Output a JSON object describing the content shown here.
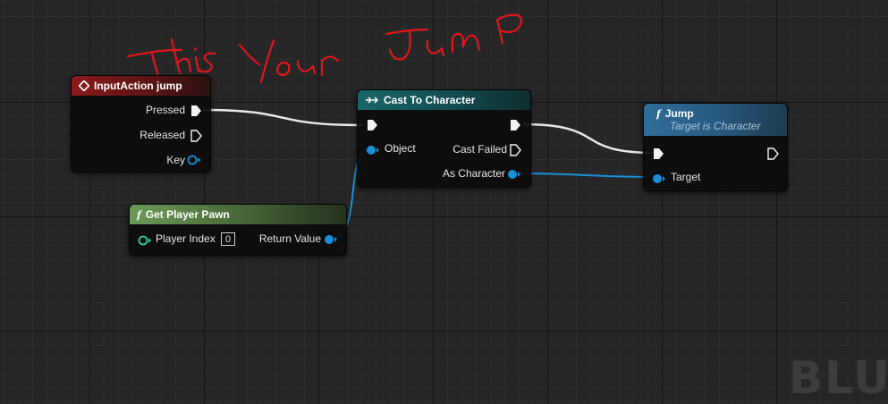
{
  "annotation": {
    "handwritten_text": "This Your Jump",
    "color": "#e0161c"
  },
  "watermark": {
    "text": "BLU"
  },
  "nodes": {
    "input_action": {
      "title": "InputAction jump",
      "icon": "diamond-event-icon",
      "pins": {
        "pressed": "Pressed",
        "released": "Released",
        "key": "Key"
      }
    },
    "cast": {
      "title": "Cast To Character",
      "icon": "cast-arrows-icon",
      "pins": {
        "object": "Object",
        "cast_failed": "Cast Failed",
        "as_character": "As Character"
      }
    },
    "get_player_pawn": {
      "title": "Get Player Pawn",
      "icon": "function-icon",
      "pins": {
        "player_index": "Player Index",
        "player_index_value": "0",
        "return_value": "Return Value"
      }
    },
    "jump": {
      "title": "Jump",
      "subtitle": "Target is Character",
      "icon": "function-icon",
      "pins": {
        "target": "Target"
      }
    }
  },
  "colors": {
    "exec_wire": "#e8e8e8",
    "object_wire": "#1a8fd8",
    "event_header": "#8a1a1c",
    "cast_header": "#18666a",
    "pure_header": "#6c9a58",
    "function_header": "#2f6d9a"
  }
}
